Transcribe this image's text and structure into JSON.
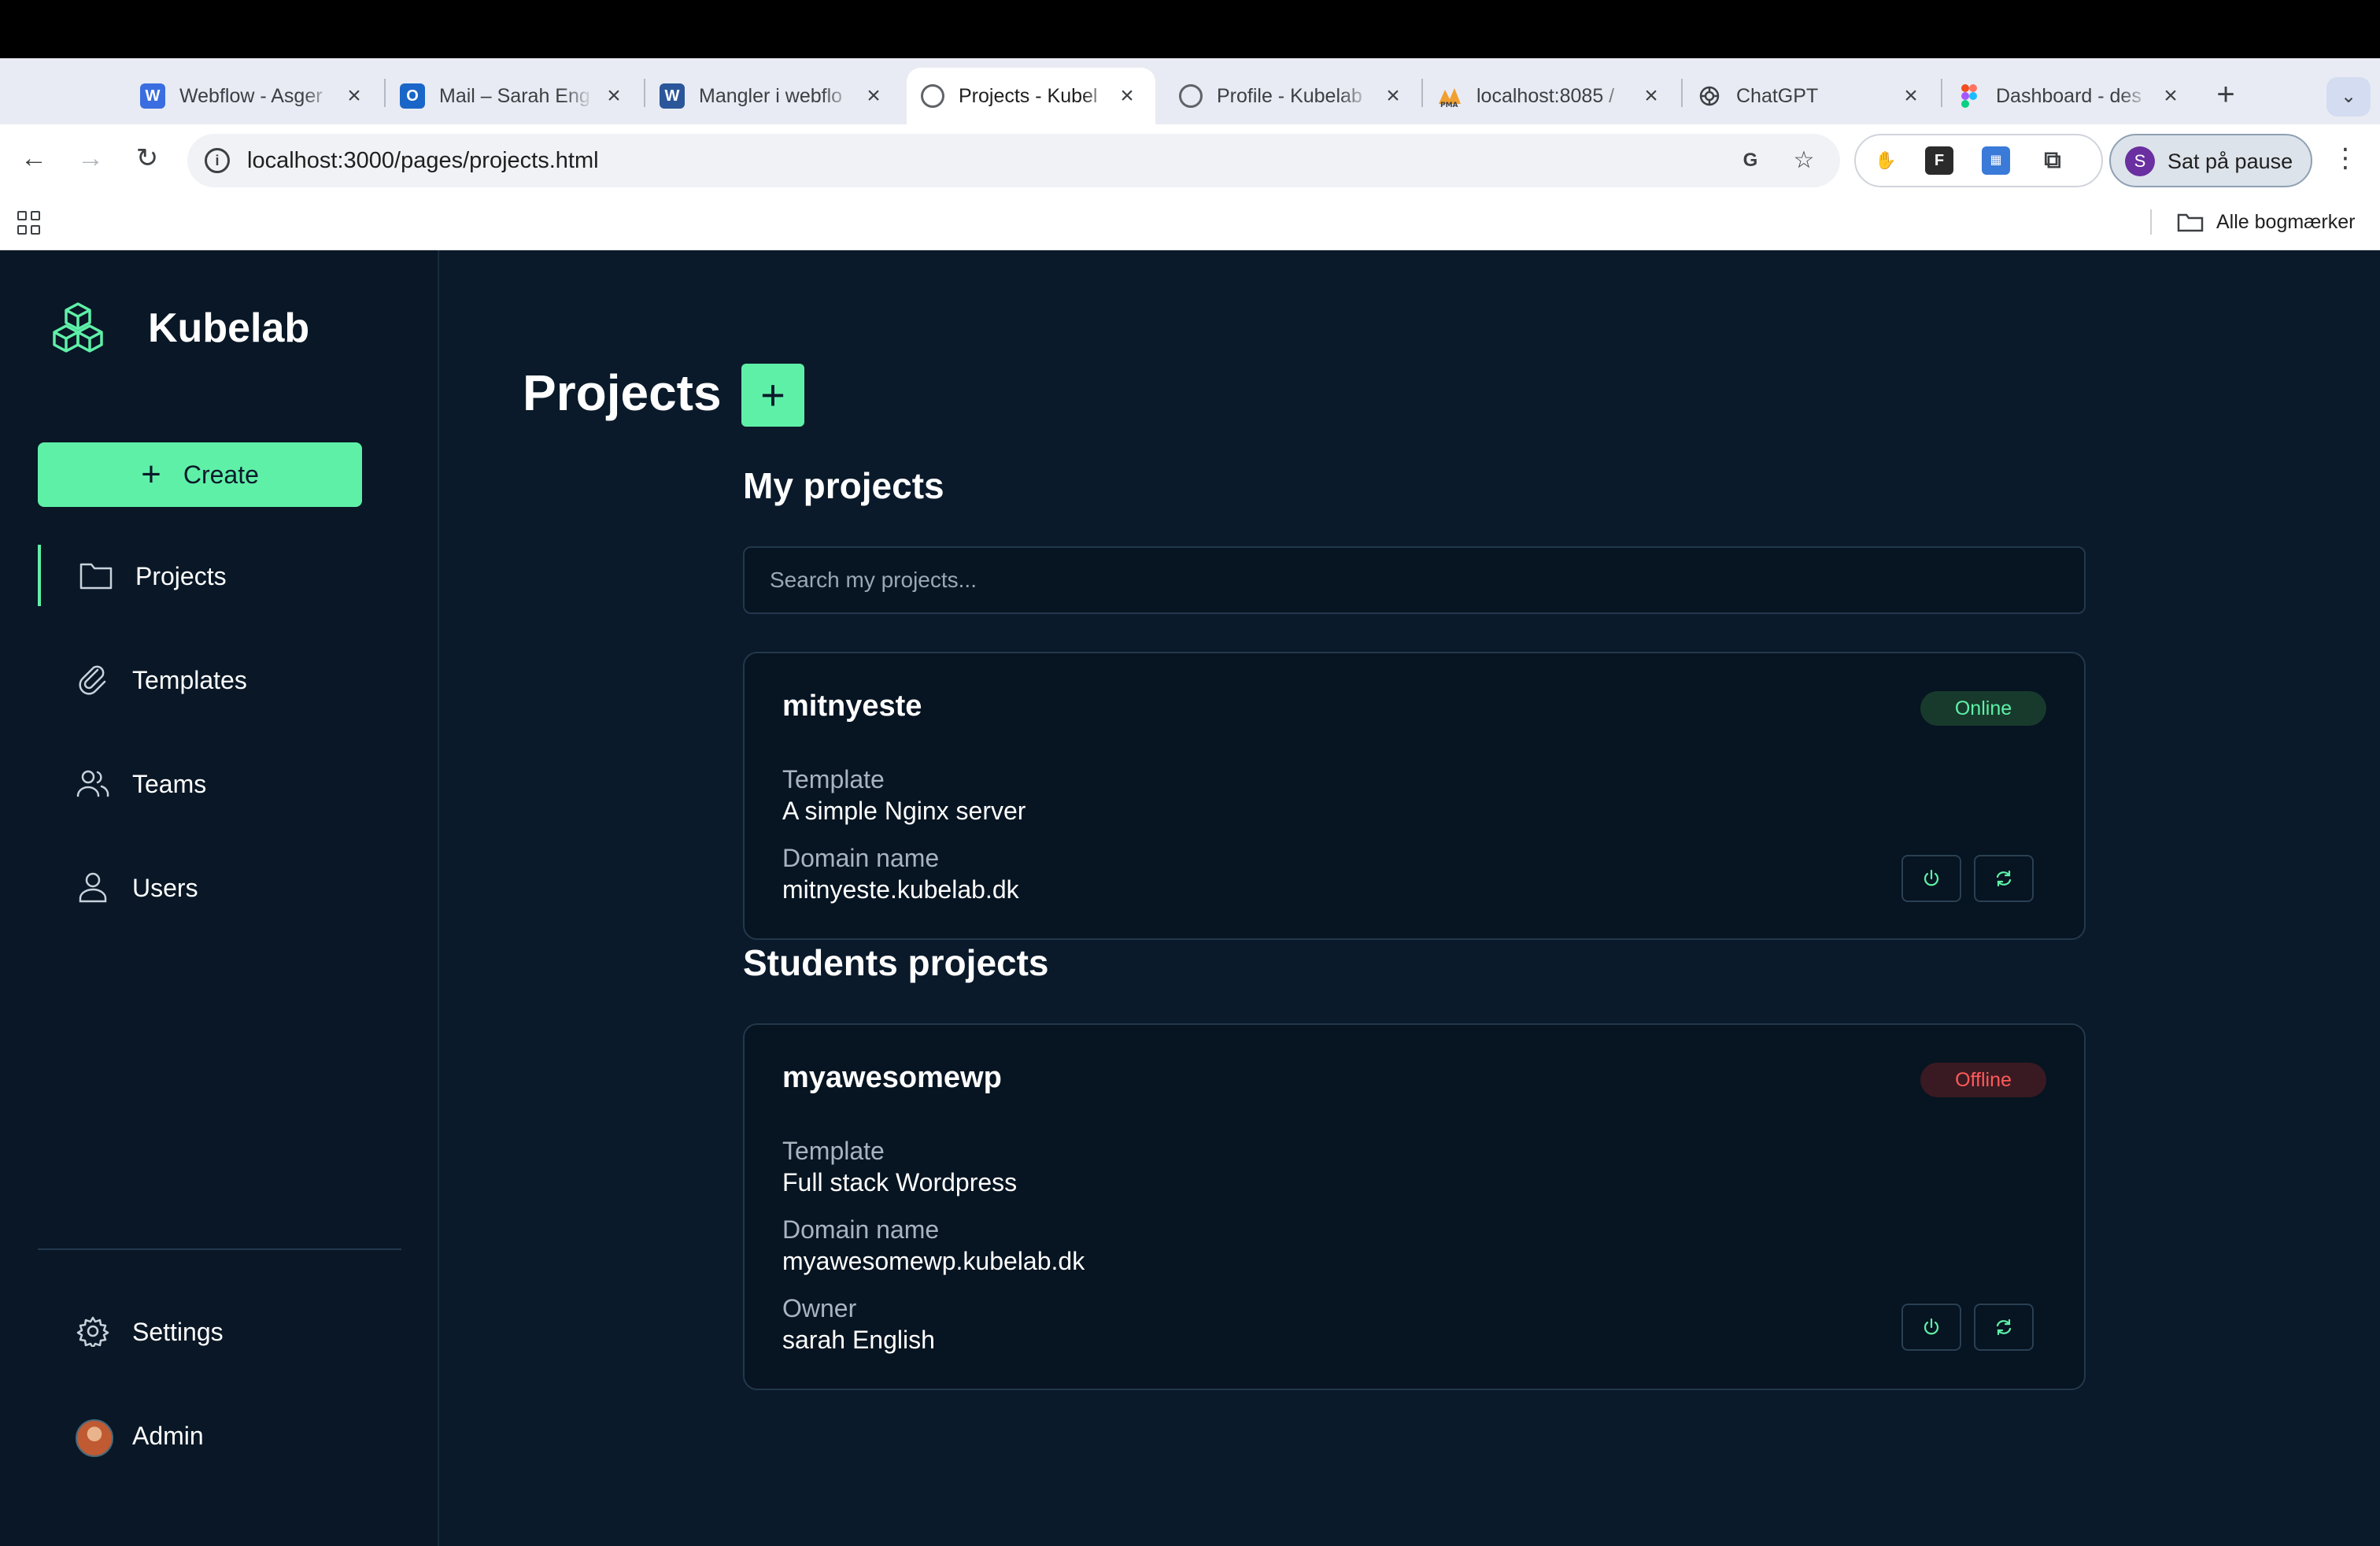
{
  "browser": {
    "tabs": [
      {
        "title": "Webflow - Asger",
        "favicon": "webflow-icon",
        "color": "#3a6ee0",
        "glyph": "W"
      },
      {
        "title": "Mail – Sarah Eng",
        "favicon": "outlook-icon",
        "color": "#1a66c8",
        "glyph": "O"
      },
      {
        "title": "Mangler i webflo",
        "favicon": "word-icon",
        "color": "#2b579a",
        "glyph": "W"
      },
      {
        "title": "Projects - Kubel",
        "favicon": "globe-icon",
        "color": "#5f6368",
        "glyph": ""
      },
      {
        "title": "Profile - Kubelab",
        "favicon": "globe-icon",
        "color": "#5f6368",
        "glyph": ""
      },
      {
        "title": "localhost:8085 /",
        "favicon": "phpmyadmin-icon",
        "color": "#f0a030",
        "glyph": ""
      },
      {
        "title": "ChatGPT",
        "favicon": "openai-icon",
        "color": "#3c4043",
        "glyph": ""
      },
      {
        "title": "Dashboard - des",
        "favicon": "figma-icon",
        "color": "#f24e1e",
        "glyph": ""
      }
    ],
    "url": "localhost:3000/pages/projects.html",
    "profile_initial": "S",
    "profile_label": "Sat på pause",
    "bookmarks_all": "Alle bogmærker"
  },
  "app": {
    "brand": "Kubelab",
    "create_label": "Create",
    "nav": {
      "projects": "Projects",
      "templates": "Templates",
      "teams": "Teams",
      "users": "Users",
      "settings": "Settings",
      "admin": "Admin"
    },
    "accent_color": "#5ff0a8"
  },
  "page": {
    "title": "Projects",
    "my_projects_heading": "My projects",
    "search_placeholder": "Search my projects...",
    "students_heading": "Students projects"
  },
  "projects": {
    "mine": {
      "name": "mitnyeste",
      "status": "Online",
      "template_label": "Template",
      "template": "A simple Nginx server",
      "domain_label": "Domain name",
      "domain": "mitnyeste.kubelab.dk"
    },
    "student": {
      "name": "myawesomewp",
      "status": "Offline",
      "template_label": "Template",
      "template": "Full stack Wordpress",
      "domain_label": "Domain name",
      "domain": "myawesomewp.kubelab.dk",
      "owner_label": "Owner",
      "owner": "sarah English"
    }
  }
}
